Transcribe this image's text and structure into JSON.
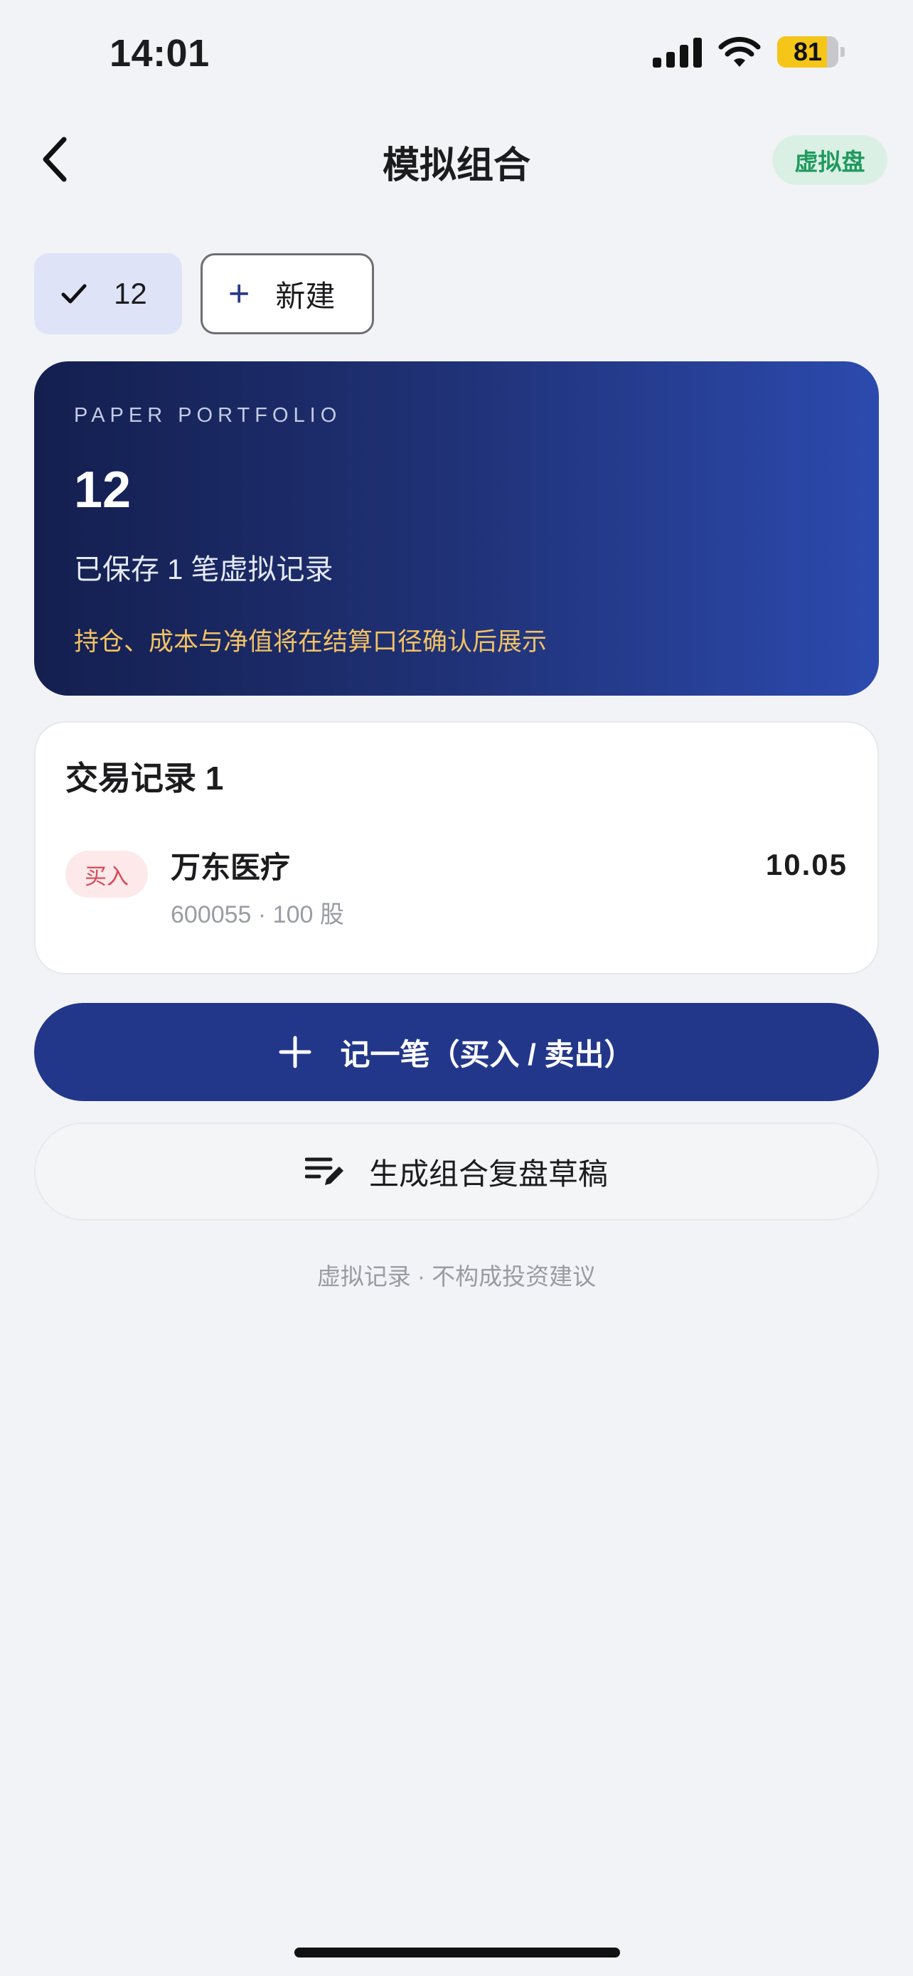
{
  "status_bar": {
    "time": "14:01",
    "battery_level": "81",
    "battery_fraction": 0.81,
    "battery_color": "#f5c518"
  },
  "header": {
    "back_icon": "chevron-left-icon",
    "title": "模拟组合",
    "mode_badge": "虚拟盘",
    "mode_badge_color": "#1f9a5e"
  },
  "portfolio_tabs": {
    "active": {
      "icon": "checkmark-icon",
      "label": "12"
    },
    "new": {
      "icon": "plus-icon",
      "label": "新建"
    }
  },
  "summary_card": {
    "eyebrow": "PAPER PORTFOLIO",
    "name": "12",
    "subtitle": "已保存 1 笔虚拟记录",
    "note": "持仓、成本与净值将在结算口径确认后展示",
    "note_color": "#f2c264"
  },
  "transactions": {
    "title": "交易记录 1",
    "items": [
      {
        "side": "买入",
        "name": "万东医疗",
        "meta": "600055 · 100 股",
        "price": "10.05"
      }
    ]
  },
  "actions": {
    "record_label": "记一笔（买入 / 卖出）",
    "draft_label": "生成组合复盘草稿",
    "draft_icon": "edit-list-icon",
    "primary_color": "#23378a"
  },
  "footer": {
    "disclaimer": "虚拟记录 · 不构成投资建议"
  }
}
